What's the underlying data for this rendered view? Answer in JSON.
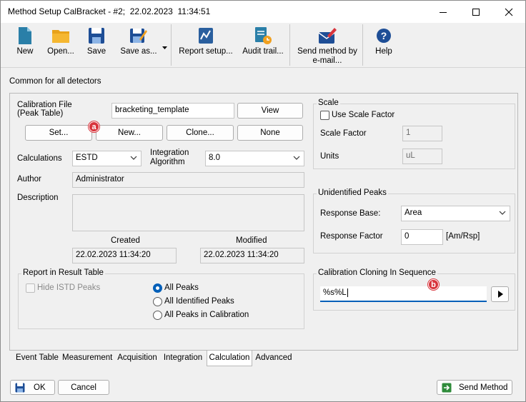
{
  "window": {
    "title": "Method Setup CalBracket - #2;  22.02.2023  11:34:51"
  },
  "toolbar": {
    "new": "New",
    "open": "Open...",
    "save": "Save",
    "save_as": "Save as...",
    "report_setup": "Report setup...",
    "audit_trail": "Audit trail...",
    "send_method_line1": "Send method by",
    "send_method_line2": "e-mail...",
    "help": "Help"
  },
  "header": {
    "text": "Common for all detectors"
  },
  "calibration": {
    "file_label_line1": "Calibration File",
    "file_label_line2": "(Peak Table)",
    "file_value": "bracketing_template",
    "view_button": "View",
    "set_button": "Set...",
    "new_button": "New...",
    "clone_button": "Clone...",
    "none_button": "None"
  },
  "calculations": {
    "label": "Calculations",
    "value": "ESTD",
    "integration_label_line1": "Integration",
    "integration_label_line2": "Algorithm",
    "integration_value": "8.0"
  },
  "author": {
    "label": "Author",
    "value": "Administrator"
  },
  "description": {
    "label": "Description",
    "value": ""
  },
  "dates": {
    "created_label": "Created",
    "created_value": "22.02.2023 11:34:20",
    "modified_label": "Modified",
    "modified_value": "22.02.2023 11:34:20"
  },
  "report": {
    "title": "Report in Result Table",
    "hide_istd": "Hide ISTD Peaks",
    "all_peaks": "All Peaks",
    "all_identified": "All Identified Peaks",
    "all_in_calibration": "All Peaks in Calibration"
  },
  "scale": {
    "title": "Scale",
    "use_scale_factor": "Use Scale Factor",
    "scale_factor_label": "Scale Factor",
    "scale_factor_value": "1",
    "units_label": "Units",
    "units_value": "uL"
  },
  "unidentified": {
    "title": "Unidentified Peaks",
    "response_base_label": "Response Base:",
    "response_base_value": "Area",
    "response_factor_label": "Response Factor",
    "response_factor_value": "0",
    "unit": "[Am/Rsp]"
  },
  "cloning": {
    "title": "Calibration Cloning In Sequence",
    "value": "%s%L"
  },
  "badges": {
    "a": "a",
    "b": "b"
  },
  "tabs": [
    "Event Table",
    "Measurement",
    "Acquisition",
    "Integration",
    "Calculation",
    "Advanced"
  ],
  "footer": {
    "ok": "OK",
    "cancel": "Cancel",
    "send_method": "Send Method"
  },
  "colors": {
    "accent": "#005fb8",
    "badge": "#d8343c",
    "icon_blue": "#1e4e96",
    "icon_orange": "#f0a020",
    "icon_teal": "#2a7fa8"
  }
}
